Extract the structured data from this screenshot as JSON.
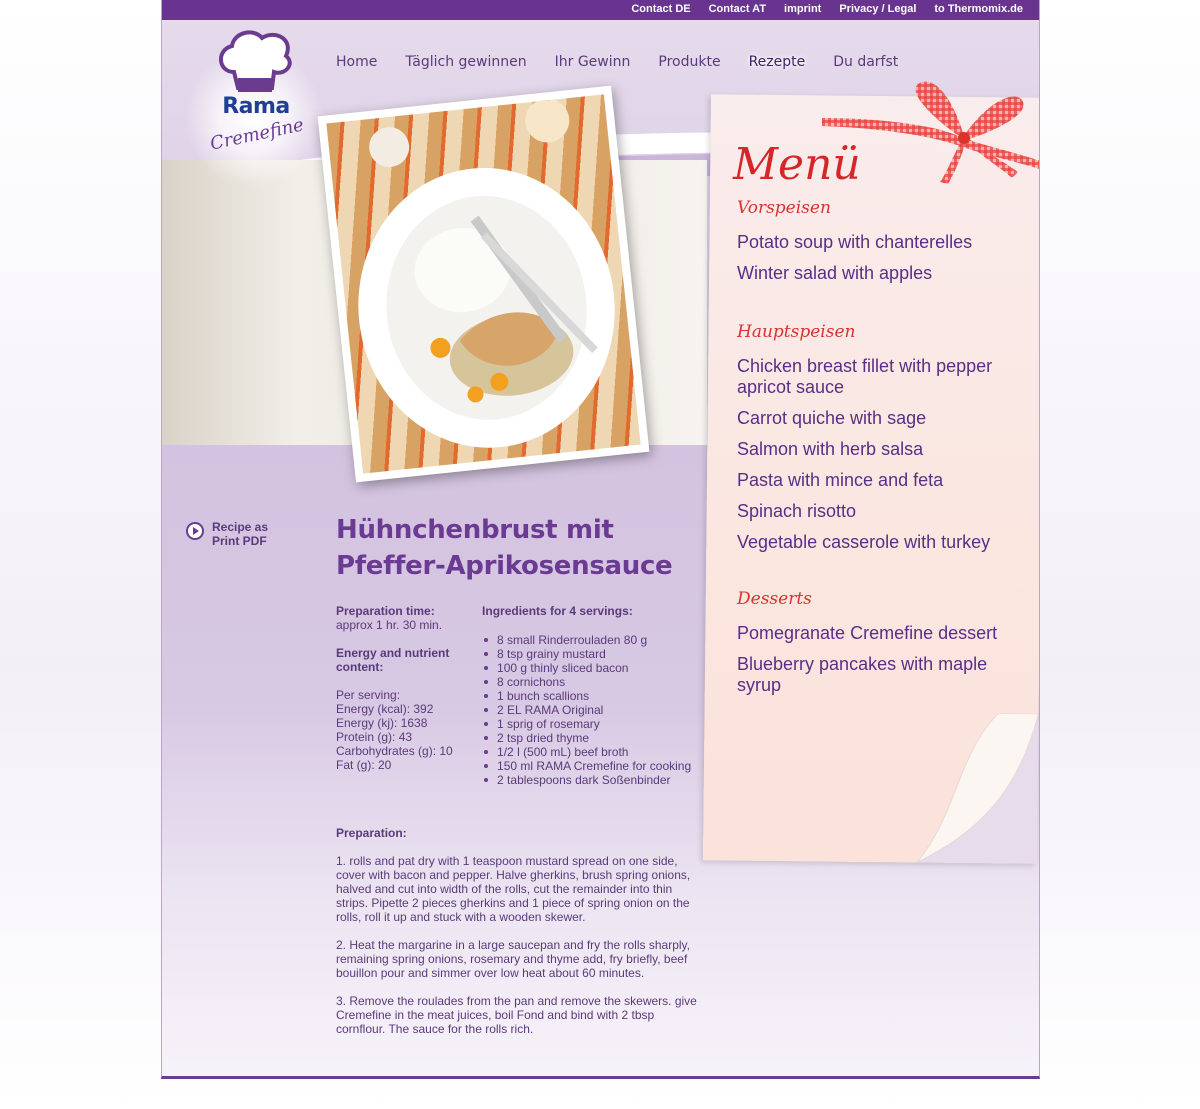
{
  "toplinks": [
    "Contact DE",
    "Contact AT",
    "imprint",
    "Privacy / Legal",
    "to Thermomix.de"
  ],
  "logo": {
    "brand": "Rama",
    "product": "Cremefine"
  },
  "nav": [
    "Home",
    "Täglich gewinnen",
    "Ihr Gewinn",
    "Produkte",
    "Rezepte",
    "Du darfst"
  ],
  "active_nav": "Rezepte",
  "pdf_link": {
    "line1": "Recipe as",
    "line2": "Print PDF"
  },
  "recipe": {
    "title_line1": "Hühnchenbrust mit",
    "title_line2": "Pfeffer-Aprikosensauce",
    "prep_time_label": "Preparation time:",
    "prep_time_value": "approx 1 hr. 30 min.",
    "energy_label": "Energy and nutrient content:",
    "per_serving": "Per serving:",
    "nutrients": [
      "Energy (kcal): 392",
      "Energy (kj): 1638",
      "Protein (g): 43",
      "Carbohydrates (g): 10",
      "Fat (g): 20"
    ],
    "ingredients_label": "Ingredients for 4 servings:",
    "ingredients": [
      "8 small Rinderrouladen 80 g",
      "8 tsp grainy mustard",
      "100 g thinly sliced bacon",
      "8 cornichons",
      "1 bunch scallions",
      "2 EL RAMA Original",
      "1 sprig of rosemary",
      "2 tsp dried thyme",
      "1/2 l (500 mL) beef broth",
      "150 ml RAMA Cremefine for cooking",
      "2 tablespoons dark Soßenbinder"
    ],
    "preparation_label": "Preparation:",
    "steps": [
      "1. rolls and pat dry with 1 teaspoon mustard spread on one side, cover with bacon and pepper. Halve gherkins, brush spring onions, halved and cut into width of the rolls, cut the remainder into thin strips. Pipette 2 pieces gherkins and 1 piece of spring onion on the rolls, roll it up and stuck with a wooden skewer.",
      "2. Heat the margarine in a large saucepan and fry the rolls sharply, remaining spring onions, rosemary and thyme add, fry briefly, beef bouillon pour and simmer over low heat about 60 minutes.",
      "3. Remove the roulades from the pan and remove the skewers. give Cremefine in the meat juices, boil Fond and bind with 2 tbsp cornflour. The sauce for the rolls rich."
    ]
  },
  "menu": {
    "title": "Menü",
    "sections": [
      {
        "name": "Vorspeisen",
        "items": [
          "Potato soup with chanterelles",
          "Winter salad with apples"
        ]
      },
      {
        "name": "Hauptspeisen",
        "items": [
          "Chicken breast fillet with pepper apricot sauce",
          "Carrot quiche with sage",
          "Salmon with herb salsa",
          "Pasta with mince and feta",
          "Spinach risotto",
          "Vegetable casserole with turkey"
        ]
      },
      {
        "name": "Desserts",
        "items": [
          "Pomegranate Cremefine dessert",
          "Blueberry pancakes with maple syrup"
        ]
      }
    ]
  },
  "colors": {
    "brand_purple": "#683490",
    "menu_red": "#d5262a",
    "text_purple": "#5a3a7a"
  }
}
